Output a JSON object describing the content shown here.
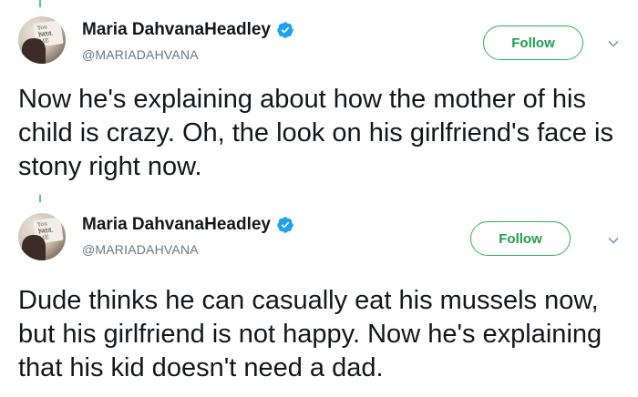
{
  "tweets": [
    {
      "author_name": "Maria DahvanaHeadley",
      "handle": "@MARIADAHVANA",
      "follow_label": "Follow",
      "text": "Now he's explaining about how the mother of his child is crazy. Oh, the look on his girlfriend's face is stony right now.",
      "verified_icon": "verified-badge-icon",
      "more_icon": "chevron-down-icon"
    },
    {
      "author_name": "Maria DahvanaHeadley",
      "handle": "@MARIADAHVANA",
      "follow_label": "Follow",
      "text": "Dude thinks he can casually eat his mussels now, but his girlfriend is not happy. Now he's explaining that his kid doesn't need a dad.",
      "verified_icon": "verified-badge-icon",
      "more_icon": "chevron-down-icon"
    }
  ],
  "colors": {
    "follow_accent": "#1f9e49",
    "verified_blue": "#1da1f2",
    "thread_line": "#4ccf7a"
  }
}
